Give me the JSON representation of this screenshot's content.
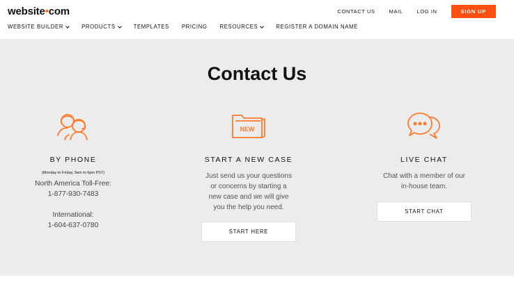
{
  "brand": {
    "logo_pre": "website",
    "logo_dot": "•",
    "logo_post": "com",
    "accent_color": "#ff4f12"
  },
  "top_links": {
    "contact": "CONTACT US",
    "mail": "MAIL",
    "login": "LOG IN",
    "signup": "SIGN UP"
  },
  "nav": {
    "items": [
      {
        "label": "WEBSITE BUILDER",
        "dropdown": true
      },
      {
        "label": "PRODUCTS",
        "dropdown": true
      },
      {
        "label": "TEMPLATES",
        "dropdown": false
      },
      {
        "label": "PRICING",
        "dropdown": false
      },
      {
        "label": "RESOURCES",
        "dropdown": true
      },
      {
        "label": "REGISTER A DOMAIN NAME",
        "dropdown": false
      }
    ]
  },
  "page": {
    "title": "Contact Us"
  },
  "columns": {
    "phone": {
      "icon": "headset-people-icon",
      "heading": "BY PHONE",
      "hours": "(Monday to Friday, 9am to 6pm PST)",
      "na_label": "North America Toll-Free:",
      "na_number": "1-877-930-7483",
      "intl_label": "International:",
      "intl_number": "1-604-637-0780"
    },
    "case": {
      "icon": "new-folder-icon",
      "icon_text": "NEW",
      "heading": "START A NEW CASE",
      "line1": "Just send us your questions",
      "line2": "or concerns by starting a",
      "line3": "new case and we will give",
      "line4": "you the help you need.",
      "button": "START HERE"
    },
    "chat": {
      "icon": "chat-bubbles-icon",
      "heading": "LIVE CHAT",
      "line1": "Chat with a member of our",
      "line2": "in-house team.",
      "button": "START CHAT"
    }
  }
}
